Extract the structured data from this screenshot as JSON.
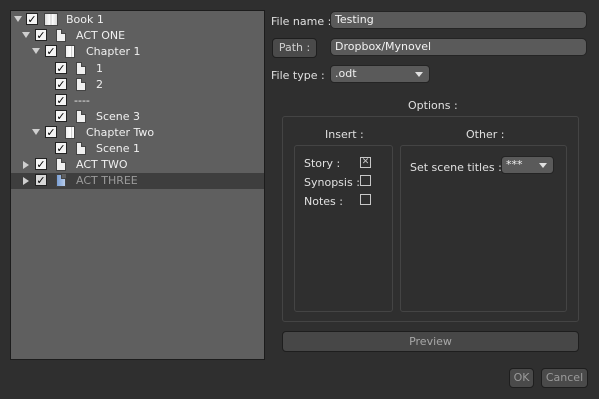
{
  "tree": [
    {
      "label": "Book 1",
      "checked": "✓",
      "arrow": "down",
      "icon": "book-icon"
    },
    {
      "label": "ACT ONE",
      "checked": "✓",
      "arrow": "down",
      "icon": "page-icon"
    },
    {
      "label": "Chapter 1",
      "checked": "✓",
      "arrow": "down",
      "icon": "folder-stack-icon"
    },
    {
      "label": "1",
      "checked": "✓",
      "icon": "document-icon"
    },
    {
      "label": "2",
      "checked": "✓",
      "icon": "document-icon"
    },
    {
      "label": "----",
      "checked": "✓"
    },
    {
      "label": "Scene 3",
      "checked": "✓",
      "icon": "document-icon"
    },
    {
      "label": "Chapter Two",
      "checked": "✓",
      "arrow": "down",
      "icon": "folder-stack-icon"
    },
    {
      "label": "Scene 1",
      "checked": "✓",
      "icon": "document-icon"
    },
    {
      "label": "ACT TWO",
      "checked": "✓",
      "arrow": "right",
      "icon": "page-icon"
    },
    {
      "label": "ACT THREE",
      "checked": "✓",
      "arrow": "right",
      "icon": "page-icon"
    }
  ],
  "form": {
    "file_name_label": "File name :",
    "file_name_value": "Testing",
    "path_button": "Path :",
    "path_value": "Dropbox/Mynovel",
    "file_type_label": "File type :",
    "file_type_value": ".odt",
    "options_label": "Options :"
  },
  "insert": {
    "title": "Insert :",
    "story_label": "Story :",
    "story_checked": "✕",
    "synopsis_label": "Synopsis :",
    "notes_label": "Notes :"
  },
  "other": {
    "title": "Other :",
    "scene_titles_label": "Set scene titles :",
    "scene_titles_value": "***"
  },
  "buttons": {
    "preview": "Preview",
    "ok": "OK",
    "cancel": "Cancel"
  }
}
